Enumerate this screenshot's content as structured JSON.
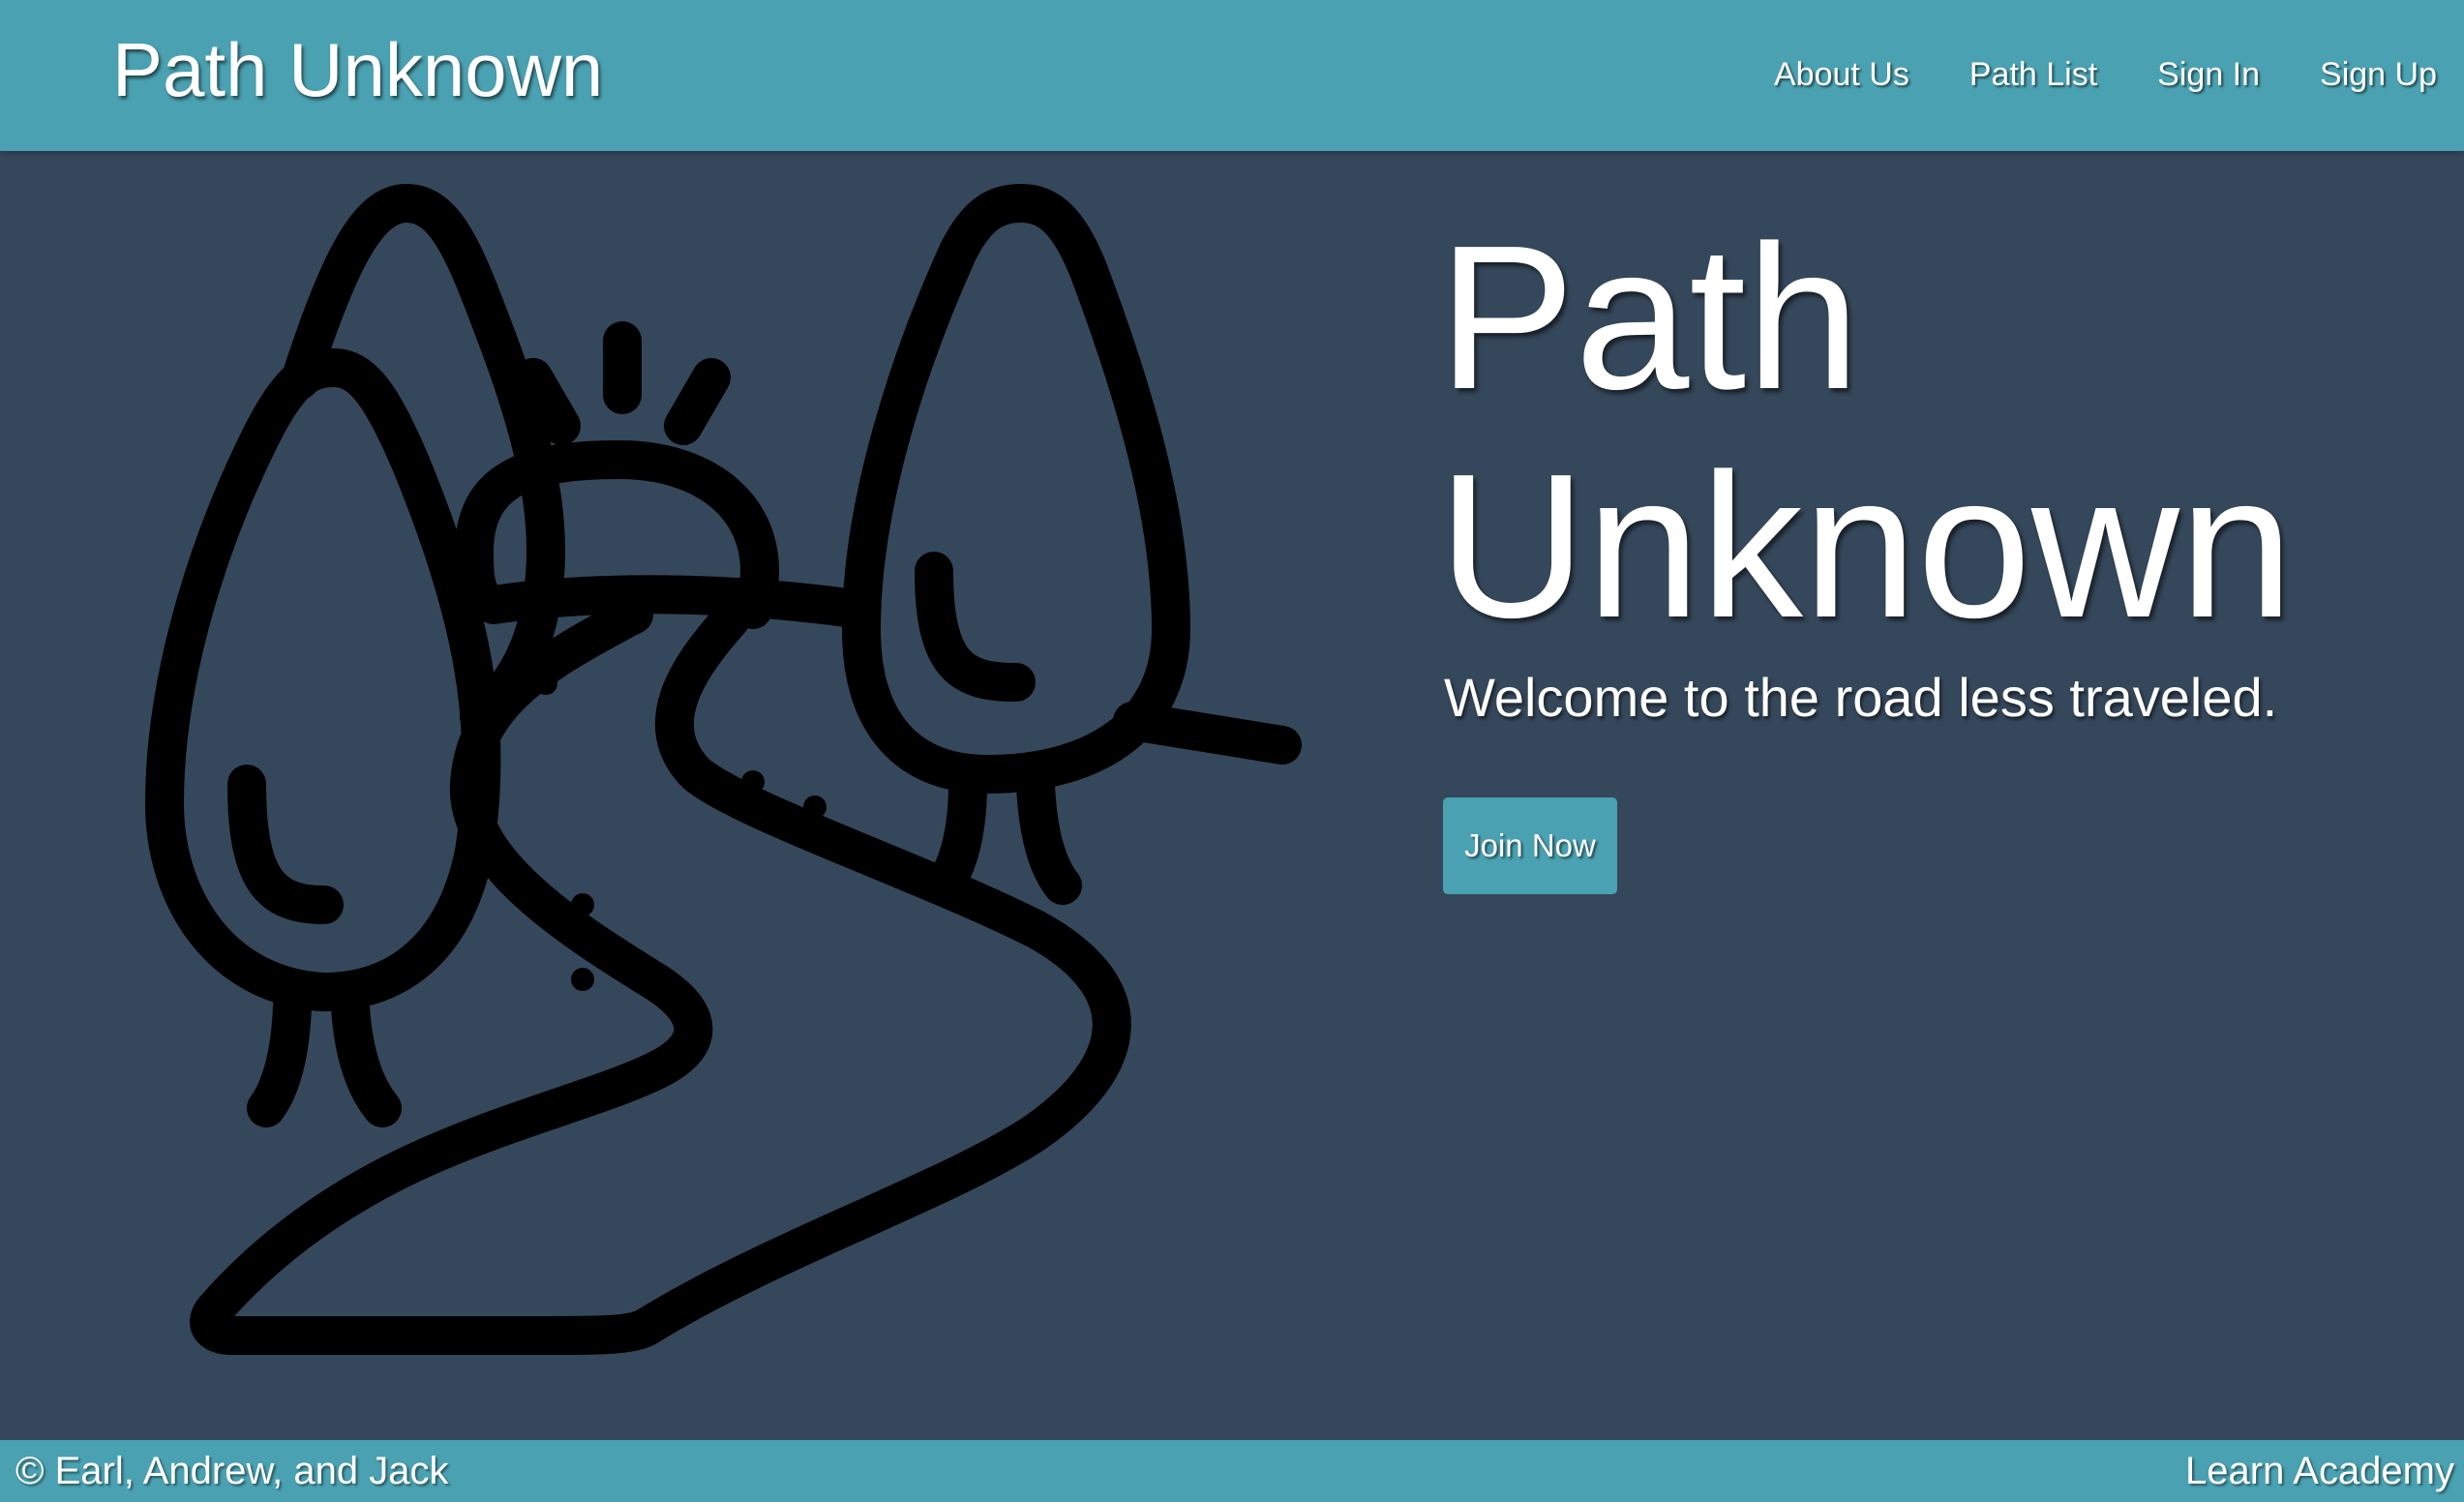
{
  "navbar": {
    "brand": "Path Unknown",
    "links": [
      "About Us",
      "Path List",
      "Sign In",
      "Sign Up"
    ]
  },
  "hero": {
    "title_line1": "Path",
    "title_line2": "Unknown",
    "subtitle": "Welcome to the road less traveled.",
    "cta_label": "Join Now",
    "illustration_icon": "trees-path-sunrise-icon"
  },
  "footer": {
    "credits": "© Earl, Andrew, and Jack",
    "org": "Learn Academy"
  },
  "colors": {
    "accent": "#4aa1b1",
    "background": "#35475a",
    "text": "#ffffff",
    "icon_stroke": "#000000"
  }
}
